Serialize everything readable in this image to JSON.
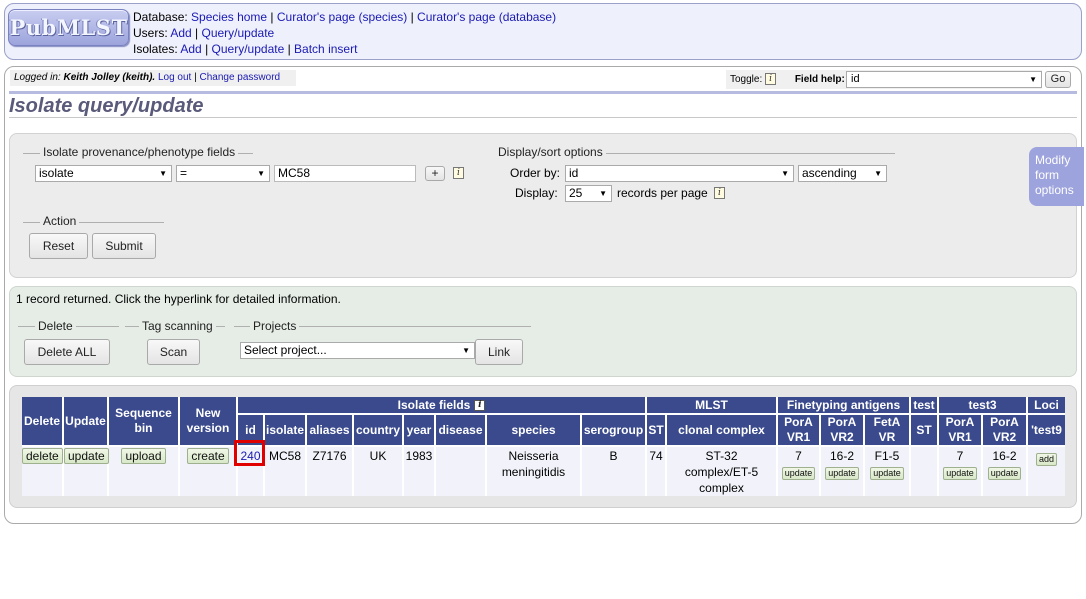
{
  "header": {
    "logo": "PubMLST",
    "database_label": "Database:",
    "database_links": [
      "Species home",
      "Curator's page (species)",
      "Curator's page (database)"
    ],
    "users_label": "Users:",
    "users_links": [
      "Add",
      "Query/update"
    ],
    "isolates_label": "Isolates:",
    "isolates_links": [
      "Add",
      "Query/update",
      "Batch insert"
    ]
  },
  "login": {
    "prefix": "Logged in: ",
    "user": "Keith Jolley (keith).",
    "logout": "Log out",
    "change_password": "Change password"
  },
  "toolbar": {
    "toggle_label": "Toggle:",
    "field_help_label": "Field help:",
    "field_help_value": "id",
    "go_label": "Go"
  },
  "page_title": "Isolate query/update",
  "query_form": {
    "provenance_legend": "Isolate provenance/phenotype fields",
    "field_select": "isolate",
    "operator_select": "=",
    "value_input": "MC58",
    "add_button": "+",
    "display_legend": "Display/sort options",
    "order_by_label": "Order by:",
    "order_by_value": "id",
    "direction_value": "ascending",
    "display_label": "Display:",
    "display_value": "25",
    "records_per_page": "records per page",
    "action_legend": "Action",
    "reset_label": "Reset",
    "submit_label": "Submit",
    "modify_tab": "Modify form options"
  },
  "results": {
    "summary": "1 record returned. Click the hyperlink for detailed information.",
    "delete_legend": "Delete",
    "delete_all_label": "Delete ALL",
    "tag_legend": "Tag scanning",
    "scan_label": "Scan",
    "projects_legend": "Projects",
    "project_select": "Select project...",
    "link_label": "Link"
  },
  "table": {
    "group_headers": {
      "isolate_fields": "Isolate fields",
      "mlst": "MLST",
      "finetyping": "Finetyping antigens",
      "test": "test",
      "test3": "test3",
      "loci": "Loci"
    },
    "columns": {
      "delete": "Delete",
      "update": "Update",
      "sequence_bin": "Sequence bin",
      "new_version": "New version",
      "id": "id",
      "isolate": "isolate",
      "aliases": "aliases",
      "country": "country",
      "year": "year",
      "disease": "disease",
      "species": "species",
      "serogroup": "serogroup",
      "st": "ST",
      "clonal_complex": "clonal complex",
      "pora_vr1": "PorA VR1",
      "pora_vr2": "PorA VR2",
      "feta_vr": "FetA VR",
      "test_st": "ST",
      "test3_pora_vr1": "PorA VR1",
      "test3_pora_vr2": "PorA VR2",
      "loci_test9": "'test9"
    },
    "row": {
      "delete": "delete",
      "update": "update",
      "sequence_bin": "upload",
      "new_version": "create",
      "id": "240",
      "isolate": "MC58",
      "aliases": "Z7176",
      "country": "UK",
      "year": "1983",
      "disease": "",
      "species": "Neisseria meningitidis",
      "serogroup": "B",
      "st": "74",
      "clonal_complex": "ST-32 complex/ET-5 complex",
      "pora_vr1": "7",
      "pora_vr2": "16-2",
      "feta_vr": "F1-5",
      "test_st": "",
      "test3_pora_vr1": "7",
      "test3_pora_vr2": "16-2",
      "scheme_update": "update",
      "loci_add": "add"
    }
  }
}
